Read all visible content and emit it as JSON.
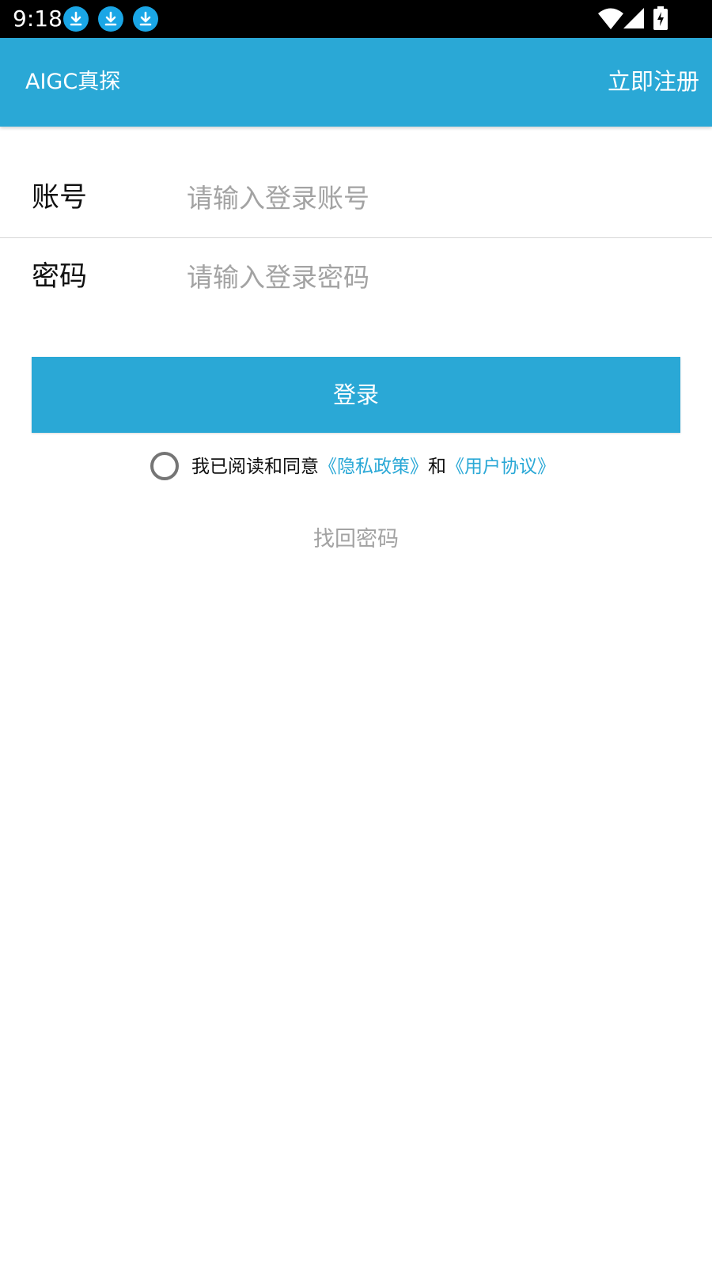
{
  "status_bar": {
    "time": "9:18",
    "notification_icons": [
      "download-icon",
      "download-icon",
      "download-icon"
    ],
    "system_icons": [
      "wifi-icon",
      "cell-signal-icon",
      "battery-charging-icon"
    ]
  },
  "app_bar": {
    "title": "AIGC真探",
    "register_label": "立即注册"
  },
  "form": {
    "account": {
      "label": "账号",
      "value": "",
      "placeholder": "请输入登录账号"
    },
    "password": {
      "label": "密码",
      "value": "",
      "placeholder": "请输入登录密码"
    }
  },
  "login_button": {
    "label": "登录"
  },
  "agreement": {
    "checked": false,
    "prefix": "我已阅读和同意",
    "privacy_link": "《隐私政策》",
    "conjunction": "和",
    "terms_link": "《用户协议》"
  },
  "forgot_password": {
    "label": "找回密码"
  },
  "colors": {
    "primary": "#2aa8d6",
    "status_bar": "#000000",
    "download_badge": "#1aa6e6",
    "placeholder": "#a3a3a3",
    "link": "#2aa8d6"
  }
}
